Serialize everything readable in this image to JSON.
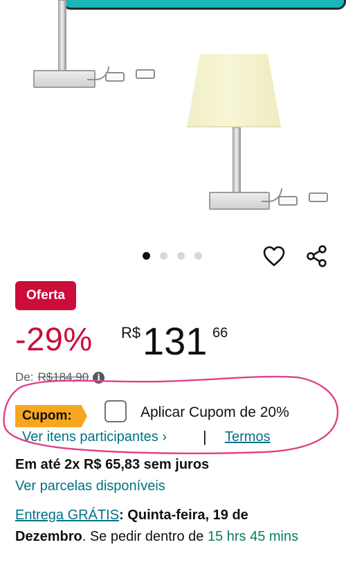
{
  "colors": {
    "deal_red": "#cc0c39",
    "link_teal": "#007185",
    "coupon_orange": "#f7a61f",
    "countdown_green": "#067d62",
    "annotation_pink": "#e0418a"
  },
  "gallery": {
    "icons": {
      "wishlist": "heart-outline-icon",
      "share": "share-icon"
    }
  },
  "deal": {
    "badge": "Oferta",
    "discount": "-29%",
    "currency": "R$",
    "price_whole": "131",
    "price_cents": "66"
  },
  "list_price": {
    "label": "De:",
    "value": "R$184,90",
    "icon": "info-icon"
  },
  "coupon": {
    "tag": "Cupom:",
    "checkbox_label": "Aplicar Cupom de 20%",
    "checked": false,
    "participants_link": "Ver itens participantes ›",
    "separator": "|",
    "terms_link": "Termos"
  },
  "installments": {
    "text": "Em até 2x R$ 65,83 sem juros",
    "link": "Ver parcelas disponíveis"
  },
  "delivery": {
    "free_link": "Entrega GRÁTIS",
    "colon": ":",
    "date": "Quinta-feira, 19 de Dezembro",
    "after_date": ". Se pedir dentro de ",
    "countdown_a": "15 hrs 45",
    "countdown_b": "mins"
  }
}
